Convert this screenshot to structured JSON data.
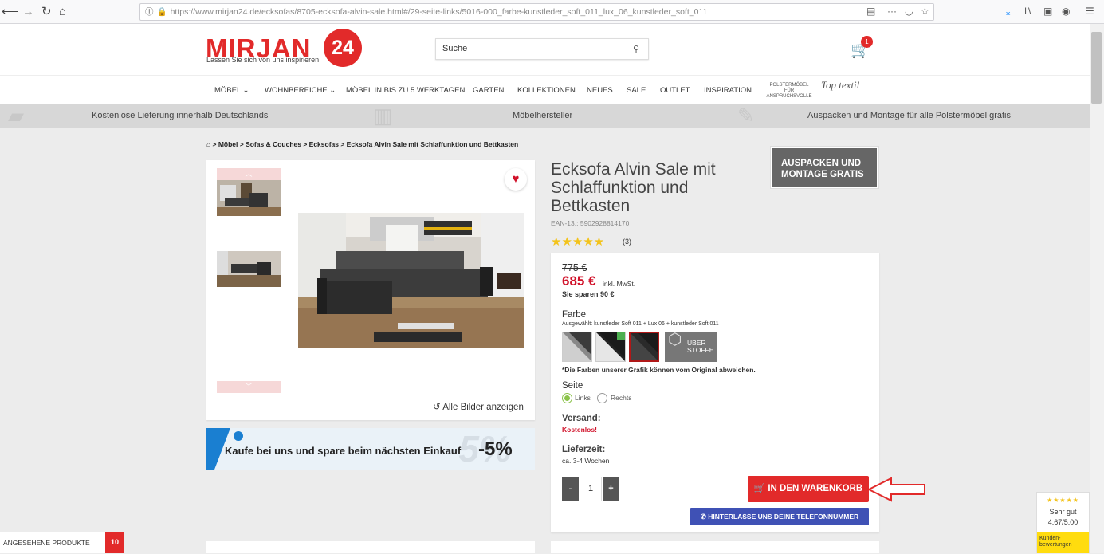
{
  "browser": {
    "url_domain": "https://www.mirjan24.de",
    "url_path": "/ecksofas/8705-ecksofa-alvin-sale.html#/29-seite-links/5016-000_farbe-kunstleder_soft_011_lux_06_kunstleder_soft_011"
  },
  "header": {
    "logo_text": "MIRJAN",
    "logo_number": "24",
    "tagline": "Lassen Sie sich von uns inspirieren",
    "search_placeholder": "Suche",
    "cart_count": "1"
  },
  "nav": {
    "items": [
      "MÖBEL ⌄",
      "WOHNBEREICHE ⌄",
      "MÖBEL IN BIS ZU 5 WERKTAGEN",
      "GARTEN",
      "KOLLEKTIONEN",
      "NEUES",
      "SALE",
      "OUTLET",
      "INSPIRATION"
    ],
    "partner_small": "POLSTERMÖBEL FÜR ANSPRUCHSVOLLE",
    "partner_logo": "Top textil"
  },
  "usp": {
    "delivery": "Kostenlose Lieferung innerhalb Deutschlands",
    "manufacturer": "Möbelhersteller",
    "assembly": "Auspacken und Montage für alle Polstermöbel gratis"
  },
  "breadcrumb": "> Möbel > Sofas & Couches > Ecksofas > Ecksofa Alvin Sale mit Schlaffunktion und Bettkasten",
  "gallery": {
    "all_images": "Alle Bilder anzeigen"
  },
  "promo": {
    "text": "Kaufe bei uns und spare beim nächsten Einkauf",
    "percent": "-5%",
    "bg_text": "-5%"
  },
  "product": {
    "title": "Ecksofa Alvin Sale mit Schlaffunktion und Bettkasten",
    "ean": "EAN-13.: 5902928814170",
    "rating_count": "(3)",
    "rating": 5,
    "montage_badge": "AUSPACKEN UND MONTAGE GRATIS",
    "old_price": "775 €",
    "new_price": "685 €",
    "tax_note": "inkl. MwSt.",
    "savings": "Sie sparen 90 €",
    "color_label": "Farbe",
    "color_selected": "Ausgewählt: kunstleder Soft 011 + Lux 06 + kunstleder Soft 011",
    "fabric_button": "ÜBER STOFFE",
    "color_note": "*Die Farben unserer Grafik können vom Original abweichen.",
    "side_label": "Seite",
    "side_options": [
      "Links",
      "Rechts"
    ],
    "shipping_label": "Versand:",
    "shipping_value": "Kostenlos!",
    "delivery_label": "Lieferzeit:",
    "delivery_value": "ca. 3-4 Wochen",
    "quantity": "1",
    "qty_minus": "-",
    "qty_plus": "+",
    "add_to_cart": "IN DEN WARENKORB",
    "callback": "HINTERLASSE UNS DEINE TELEFONNUMMER"
  },
  "footer": {
    "viewed_label": "ANGESEHENE PRODUKTE",
    "viewed_count": "10",
    "trust_label": "Sehr gut",
    "trust_score": "4.67/5.00",
    "trust_footer": "Kunden-bewertungen"
  },
  "colors": {
    "brand_red": "#e22a2a",
    "callback_blue": "#3f51b5",
    "star_yellow": "#f3c31b"
  }
}
